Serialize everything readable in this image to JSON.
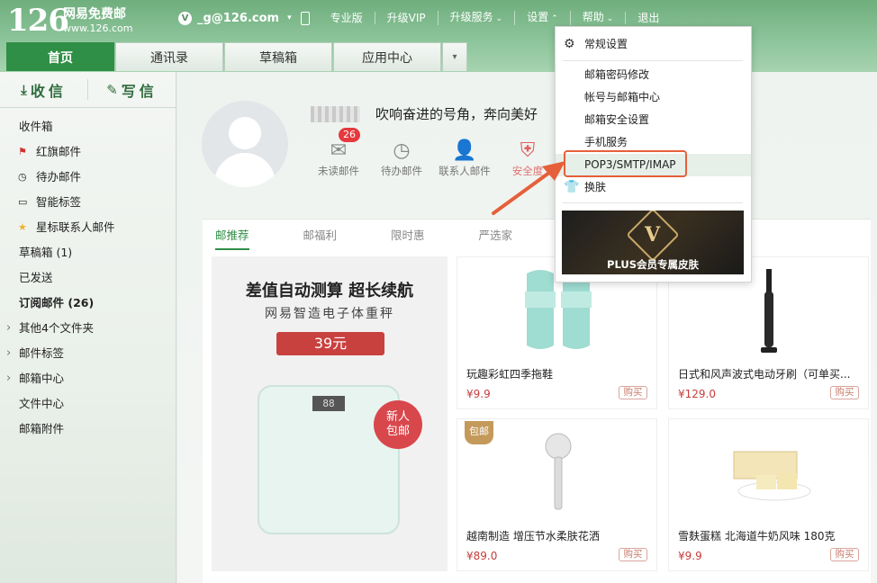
{
  "brand": {
    "logo": "126",
    "name": "网易免费邮",
    "domain": "www.126.com"
  },
  "topnav": {
    "vip_letter": "V",
    "account": "_g@126.com",
    "items": [
      "专业版",
      "升级VIP",
      "升级服务",
      "设置",
      "帮助",
      "退出"
    ]
  },
  "tabs": [
    "首页",
    "通讯录",
    "草稿箱",
    "应用中心"
  ],
  "compose": {
    "receive": "收信",
    "write": "写信"
  },
  "folders": [
    "收件箱",
    "红旗邮件",
    "待办邮件",
    "智能标签",
    "星标联系人邮件",
    "草稿箱 (1)",
    "已发送",
    "订阅邮件 (26)",
    "其他4个文件夹",
    "邮件标签",
    "邮箱中心",
    "文件中心",
    "邮箱附件"
  ],
  "profile": {
    "slogan": "吹响奋进的号角，奔向美好"
  },
  "quick": [
    {
      "label": "未读邮件",
      "badge": "26",
      "icon": "mail-icon"
    },
    {
      "label": "待办邮件",
      "icon": "clock-icon"
    },
    {
      "label": "联系人邮件",
      "icon": "contact-star-icon"
    },
    {
      "label": "安全度",
      "icon": "shield-icon"
    }
  ],
  "promo_tabs": [
    "邮推荐",
    "邮福利",
    "限时惠",
    "严选家"
  ],
  "banner": {
    "title": "差值自动测算 超长续航",
    "subtitle": "网易智造电子体重秤",
    "price": "39元",
    "lcd": "88",
    "badge_line1": "新人",
    "badge_line2": "包邮"
  },
  "products": [
    {
      "name": "玩趣彩虹四季拖鞋",
      "price": "¥9.9",
      "buy": "购买"
    },
    {
      "name": "日式和风声波式电动牙刷（可单买...",
      "price": "¥129.0",
      "buy": "购买"
    },
    {
      "name": "越南制造 增压节水柔肤花洒",
      "price": "¥89.0",
      "buy": "购买",
      "tag": "包邮"
    },
    {
      "name": "雪麸蛋糕 北海道牛奶风味 180克",
      "price": "¥9.9",
      "buy": "购买"
    }
  ],
  "settings_menu": {
    "general": "常规设置",
    "items": [
      "邮箱密码修改",
      "帐号与邮箱中心",
      "邮箱安全设置",
      "手机服务",
      "POP3/SMTP/IMAP"
    ],
    "skin": "换肤",
    "skin_banner": "PLUS会员专属皮肤",
    "skin_letter": "V"
  },
  "colors": {
    "accent": "#2f8f46",
    "highlight": "#e5603a",
    "price": "#c43d3b"
  }
}
